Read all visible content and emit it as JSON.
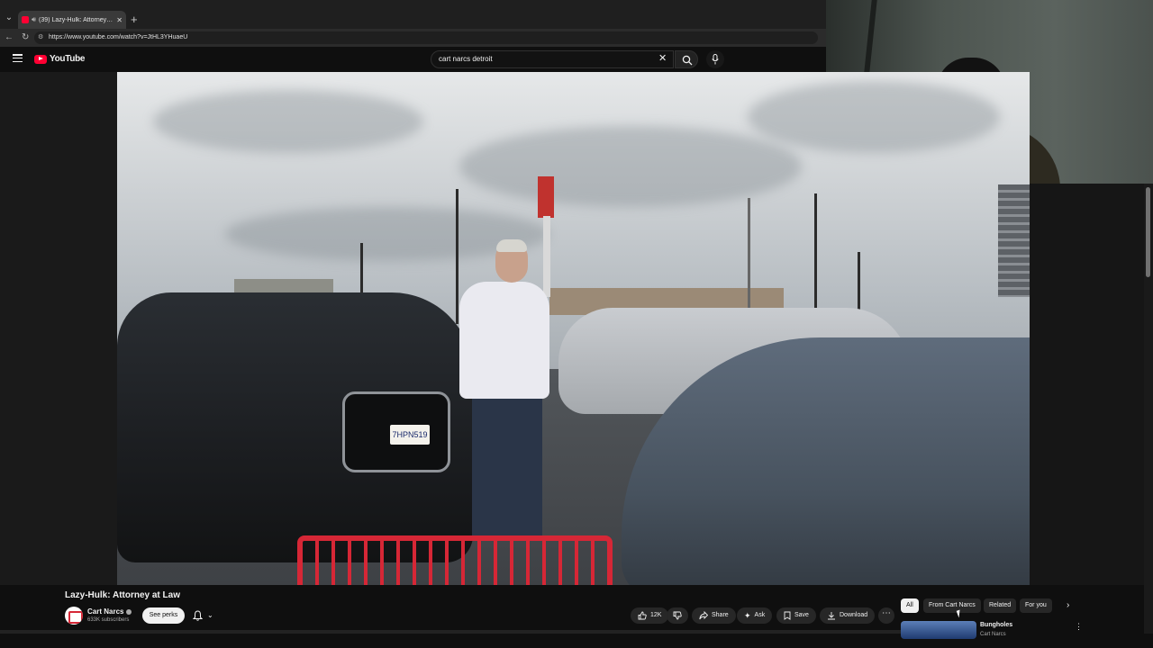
{
  "browser": {
    "tab_title": "(39) Lazy-Hulk: Attorney at Law",
    "url": "https://www.youtube.com/watch?v=JtHL3YHuaeU",
    "new_tab_icon": "plus-icon"
  },
  "youtube": {
    "logo_text": "YouTube",
    "search_query": "cart narcs detroit"
  },
  "video": {
    "license_plate": "7HPN519"
  },
  "info": {
    "title": "Lazy-Hulk: Attorney at Law",
    "channel_name": "Cart Narcs",
    "subscribers": "633K subscribers",
    "perks_label": "See perks",
    "like_count": "12K",
    "share_label": "Share",
    "ask_label": "Ask",
    "save_label": "Save",
    "download_label": "Download"
  },
  "recommendations": {
    "chips": [
      "All",
      "From Cart Narcs",
      "Related",
      "For you"
    ],
    "items": [
      {
        "title": "Bungholes",
        "channel": "Cart Narcs"
      }
    ]
  },
  "colors": {
    "brand_red": "#ff0033",
    "background": "#0f0f0f",
    "cart_red": "#d62736"
  }
}
